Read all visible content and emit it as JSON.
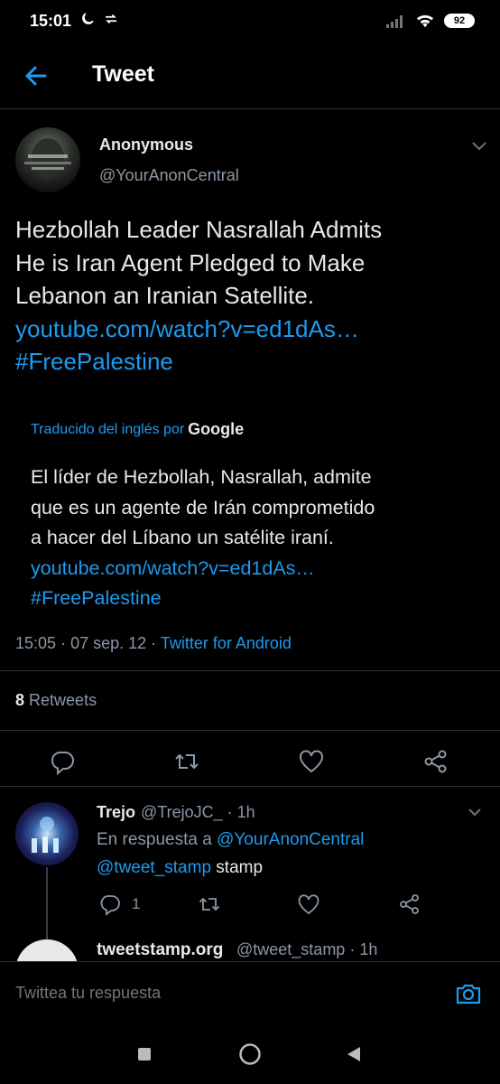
{
  "status_bar": {
    "time": "15:01",
    "battery": "92"
  },
  "header": {
    "title": "Tweet"
  },
  "tweet": {
    "author_name": "Anonymous",
    "author_handle": "@YourAnonCentral",
    "text_line1": "Hezbollah Leader Nasrallah Admits",
    "text_line2": "He is Iran Agent Pledged to Make",
    "text_line3": "Lebanon an Iranian Satellite.",
    "link": "youtube.com/watch?v=ed1dAs…",
    "hashtag": "#FreePalestine",
    "translated_by": "Traducido del inglés por",
    "translator": "Google",
    "translation_line1": "El líder de Hezbollah, Nasrallah, admite",
    "translation_line2": "que es un agente de Irán comprometido",
    "translation_line3": "a hacer del Líbano un satélite iraní.",
    "translation_link": "youtube.com/watch?v=ed1dAs…",
    "translation_hashtag": "#FreePalestine",
    "time": "15:05",
    "date": "07 sep. 12",
    "source": "Twitter for Android",
    "retweet_count": "8",
    "retweet_label": "Retweets"
  },
  "reply": {
    "name": "Trejo",
    "handle_time": "@TrejoJC_ · 1h",
    "context_prefix": "En respuesta a",
    "context_handle": "@YourAnonCentral",
    "mention": "@tweet_stamp",
    "body_text": "stamp",
    "reply_count": "1"
  },
  "next_reply": {
    "name": "tweetstamp.org",
    "handle_time": "@tweet_stamp · 1h"
  },
  "compose": {
    "placeholder": "Twittea tu respuesta"
  },
  "colors": {
    "accent": "#1d9bf0",
    "muted": "#8b98a5",
    "background": "#000000"
  },
  "icons": [
    "back-arrow-icon",
    "chevron-down-icon",
    "reply-icon",
    "retweet-icon",
    "like-icon",
    "share-icon",
    "camera-icon"
  ]
}
